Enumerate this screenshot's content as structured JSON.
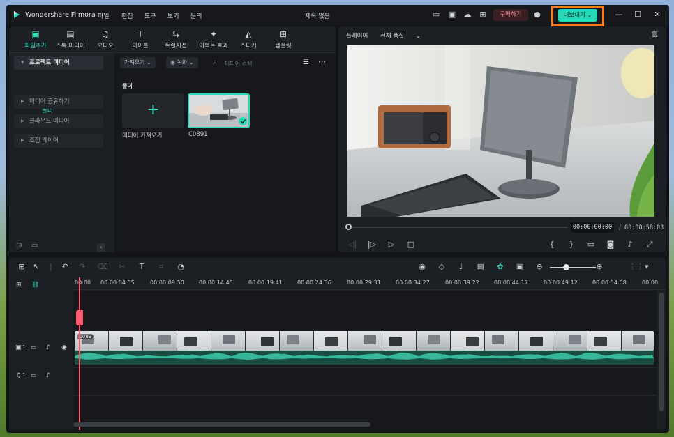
{
  "titlebar": {
    "app_name": "Wondershare Filmora",
    "menus": [
      "파일",
      "편집",
      "도구",
      "보기",
      "문의"
    ],
    "project_title": "제목 없음",
    "buy_label": "구매하기",
    "export_label": "내보내기"
  },
  "library": {
    "tabs": [
      {
        "label": "파일추가",
        "icon": "folder-media-icon"
      },
      {
        "label": "스톡 미디어",
        "icon": "stock-media-icon"
      },
      {
        "label": "오디오",
        "icon": "music-note-icon"
      },
      {
        "label": "타이틀",
        "icon": "title-t-icon"
      },
      {
        "label": "트랜지션",
        "icon": "transition-icon"
      },
      {
        "label": "이펙트 효과",
        "icon": "effects-icon"
      },
      {
        "label": "스티커",
        "icon": "sticker-icon"
      },
      {
        "label": "템플릿",
        "icon": "template-icon"
      }
    ],
    "sidebar": {
      "items": [
        "프로젝트 미디어",
        "미디어 공유하기",
        "클라우드 미디어",
        "조정 레이어"
      ],
      "sub_item": "폴더"
    },
    "toolbar": {
      "import_label": "가져오기",
      "record_label": "녹화",
      "search_placeholder": "미디어 검색"
    },
    "folder_heading": "폴더",
    "import_card_label": "미디어 가져오기",
    "clip_name": "C0891"
  },
  "player": {
    "label": "플레이어",
    "quality": "전체 품질",
    "current_time": "00:00:00:00",
    "separator": "/",
    "total_time": "00:00:58:03"
  },
  "timeline": {
    "ruler_labels": [
      "00:00",
      "00:00:04:55",
      "00:00:09:50",
      "00:00:14:45",
      "00:00:19:41",
      "00:00:24:36",
      "00:00:29:31",
      "00:00:34:27",
      "00:00:39:22",
      "00:00:44:17",
      "00:00:49:12",
      "00:00:54:08",
      "00:00"
    ],
    "video_track_number": "1",
    "audio_track_number": "1",
    "clip_tag": "C089"
  },
  "colors": {
    "accent": "#2fe0bd",
    "export_bg": "#25d9b8",
    "highlight_frame": "#ff7a1a",
    "playhead": "#ff5a6e",
    "buy_text": "#ff8a9a"
  }
}
